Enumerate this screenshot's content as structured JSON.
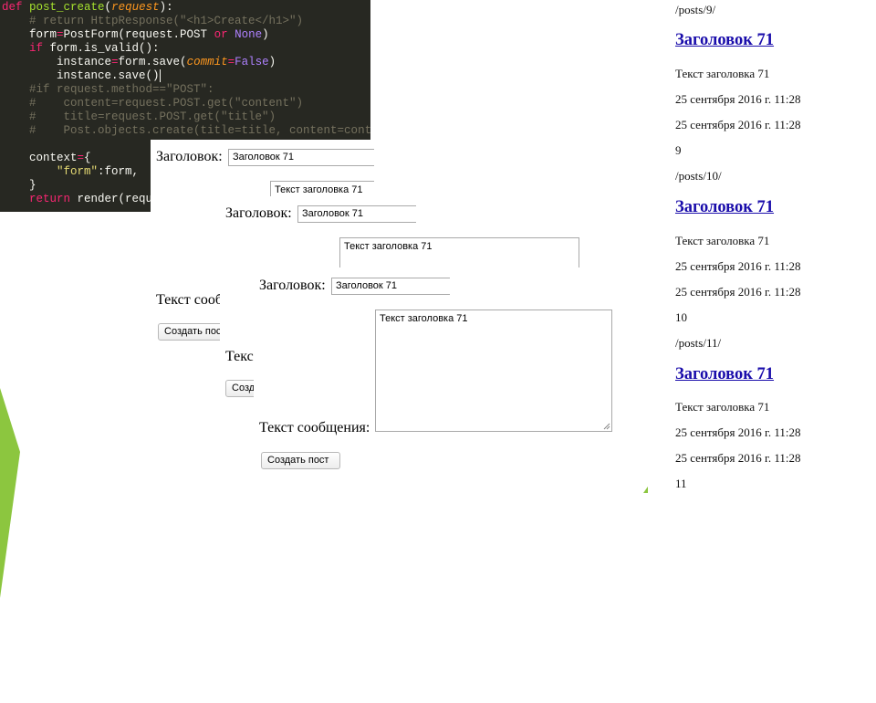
{
  "code": {
    "lines": [
      "def post_create(request):",
      "    # return HttpResponse(\"<h1>Create</h1>\")",
      "    form=PostForm(request.POST or None)",
      "    if form.is_valid():",
      "        instance=form.save(commit=False)",
      "        instance.save()",
      "    #if request.method==\"POST\":",
      "    #    content=request.POST.get(\"content\")",
      "    #    title=request.POST.get(\"title\")",
      "    #    Post.objects.create(title=title, content=content)",
      "",
      "    context={",
      "        \"form\":form,",
      "    }",
      "    return render(request"
    ]
  },
  "forms": [
    {
      "title_label": "Заголовок:",
      "title_value": "Заголовок 71",
      "content_value": "Текст заголовка 71",
      "message_label": "Текст сообщения:",
      "message_label_visible": "Текст сооб",
      "submit_label": "Создать пос"
    },
    {
      "title_label": "Заголовок:",
      "title_value": "Заголовок 71",
      "content_value": "Текст заголовка 71",
      "message_label_visible": "Текст",
      "submit_label": "Созд"
    },
    {
      "title_label": "Заголовок:",
      "title_value": "Заголовок 71",
      "content_value": "Текст заголовка 71",
      "message_label": "Текст сообщения:",
      "submit_label": "Создать пост"
    }
  ],
  "posts": [
    {
      "path": "/posts/9/",
      "title": "Заголовок 71",
      "text": "Текст заголовка 71",
      "created": "25 сентября 2016 г. 11:28",
      "updated": "25 сентября 2016 г. 11:28",
      "id": "9"
    },
    {
      "path": "/posts/10/",
      "title": "Заголовок 71",
      "text": "Текст заголовка 71",
      "created": "25 сентября 2016 г. 11:28",
      "updated": "25 сентября 2016 г. 11:28",
      "id": "10"
    },
    {
      "path": "/posts/11/",
      "title": "Заголовок 71",
      "text": "Текст заголовка 71",
      "created": "25 сентября 2016 г. 11:28",
      "updated": "25 сентября 2016 г. 11:28",
      "id": "11"
    }
  ],
  "colors": {
    "accent_green": "#8cc63f",
    "code_background": "#272822",
    "link": "#1a0dab"
  }
}
